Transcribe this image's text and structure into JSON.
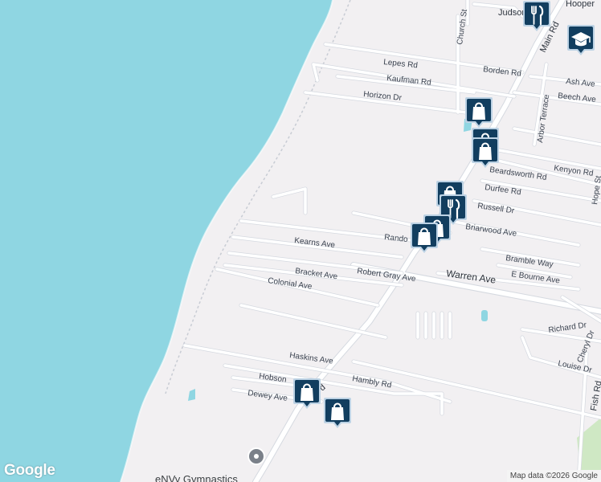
{
  "map": {
    "colors": {
      "water": "#8fd6e2",
      "land": "#f2f0f2",
      "road": "#ffffff",
      "road_edge": "#d5d9e0",
      "marker": "#123e5f",
      "marker_border": "#bcd2e4"
    },
    "roads": {
      "judson": "Judson",
      "hooper": "Hooper",
      "church_st": "Church St",
      "main_rd": "Main Rd",
      "lepes_rd": "Lepes Rd",
      "borden_rd": "Borden Rd",
      "kaufman_rd": "Kaufman Rd",
      "ash_ave": "Ash Ave",
      "beech_ave": "Beech Ave",
      "horizon_dr": "Horizon Dr",
      "arbor_terrace": "Arbor Terrace",
      "kenyon_rd": "Kenyon Rd",
      "beardsworth_rd": "Beardsworth Rd",
      "hope_st": "Hope St",
      "durfee_rd": "Durfee Rd",
      "russell_dr": "Russell Dr",
      "briarwood_ave": "Briarwood Ave",
      "kearns_ave": "Kearns Ave",
      "rando": "Rando",
      "bramble_way": "Bramble Way",
      "e_bourne_ave": "E Bourne Ave",
      "robert_gray_ave": "Robert Gray Ave",
      "warren_ave": "Warren Ave",
      "bracket_ave": "Bracket Ave",
      "colonial_ave": "Colonial Ave",
      "richard_dr": "Richard Dr",
      "cheryl_dr": "Cheryl Dr",
      "haskins_ave": "Haskins Ave",
      "louise_dr": "Louise Dr",
      "fish_rd": "Fish Rd",
      "hobson": "Hobson",
      "hambly_rd": "Hambly Rd",
      "dewey_ave": "Dewey Ave",
      "rd_fragment": "d"
    },
    "place": {
      "name": "eNVy Gymnastics"
    },
    "pois": [
      {
        "type": "restaurant",
        "icon": "fork-knife-icon"
      },
      {
        "type": "school",
        "icon": "graduation-cap-icon"
      },
      {
        "type": "shopping",
        "icon": "shopping-bag-icon"
      },
      {
        "type": "shopping",
        "icon": "shopping-bag-icon"
      },
      {
        "type": "shopping",
        "icon": "shopping-bag-icon"
      },
      {
        "type": "shopping",
        "icon": "shopping-bag-icon"
      },
      {
        "type": "restaurant",
        "icon": "fork-knife-icon"
      },
      {
        "type": "shopping",
        "icon": "shopping-bag-icon"
      },
      {
        "type": "shopping",
        "icon": "shopping-bag-icon"
      },
      {
        "type": "shopping",
        "icon": "shopping-bag-icon"
      },
      {
        "type": "shopping",
        "icon": "shopping-bag-icon"
      }
    ],
    "branding": {
      "logo": "Google",
      "attribution": "Map data ©2026 Google"
    }
  }
}
